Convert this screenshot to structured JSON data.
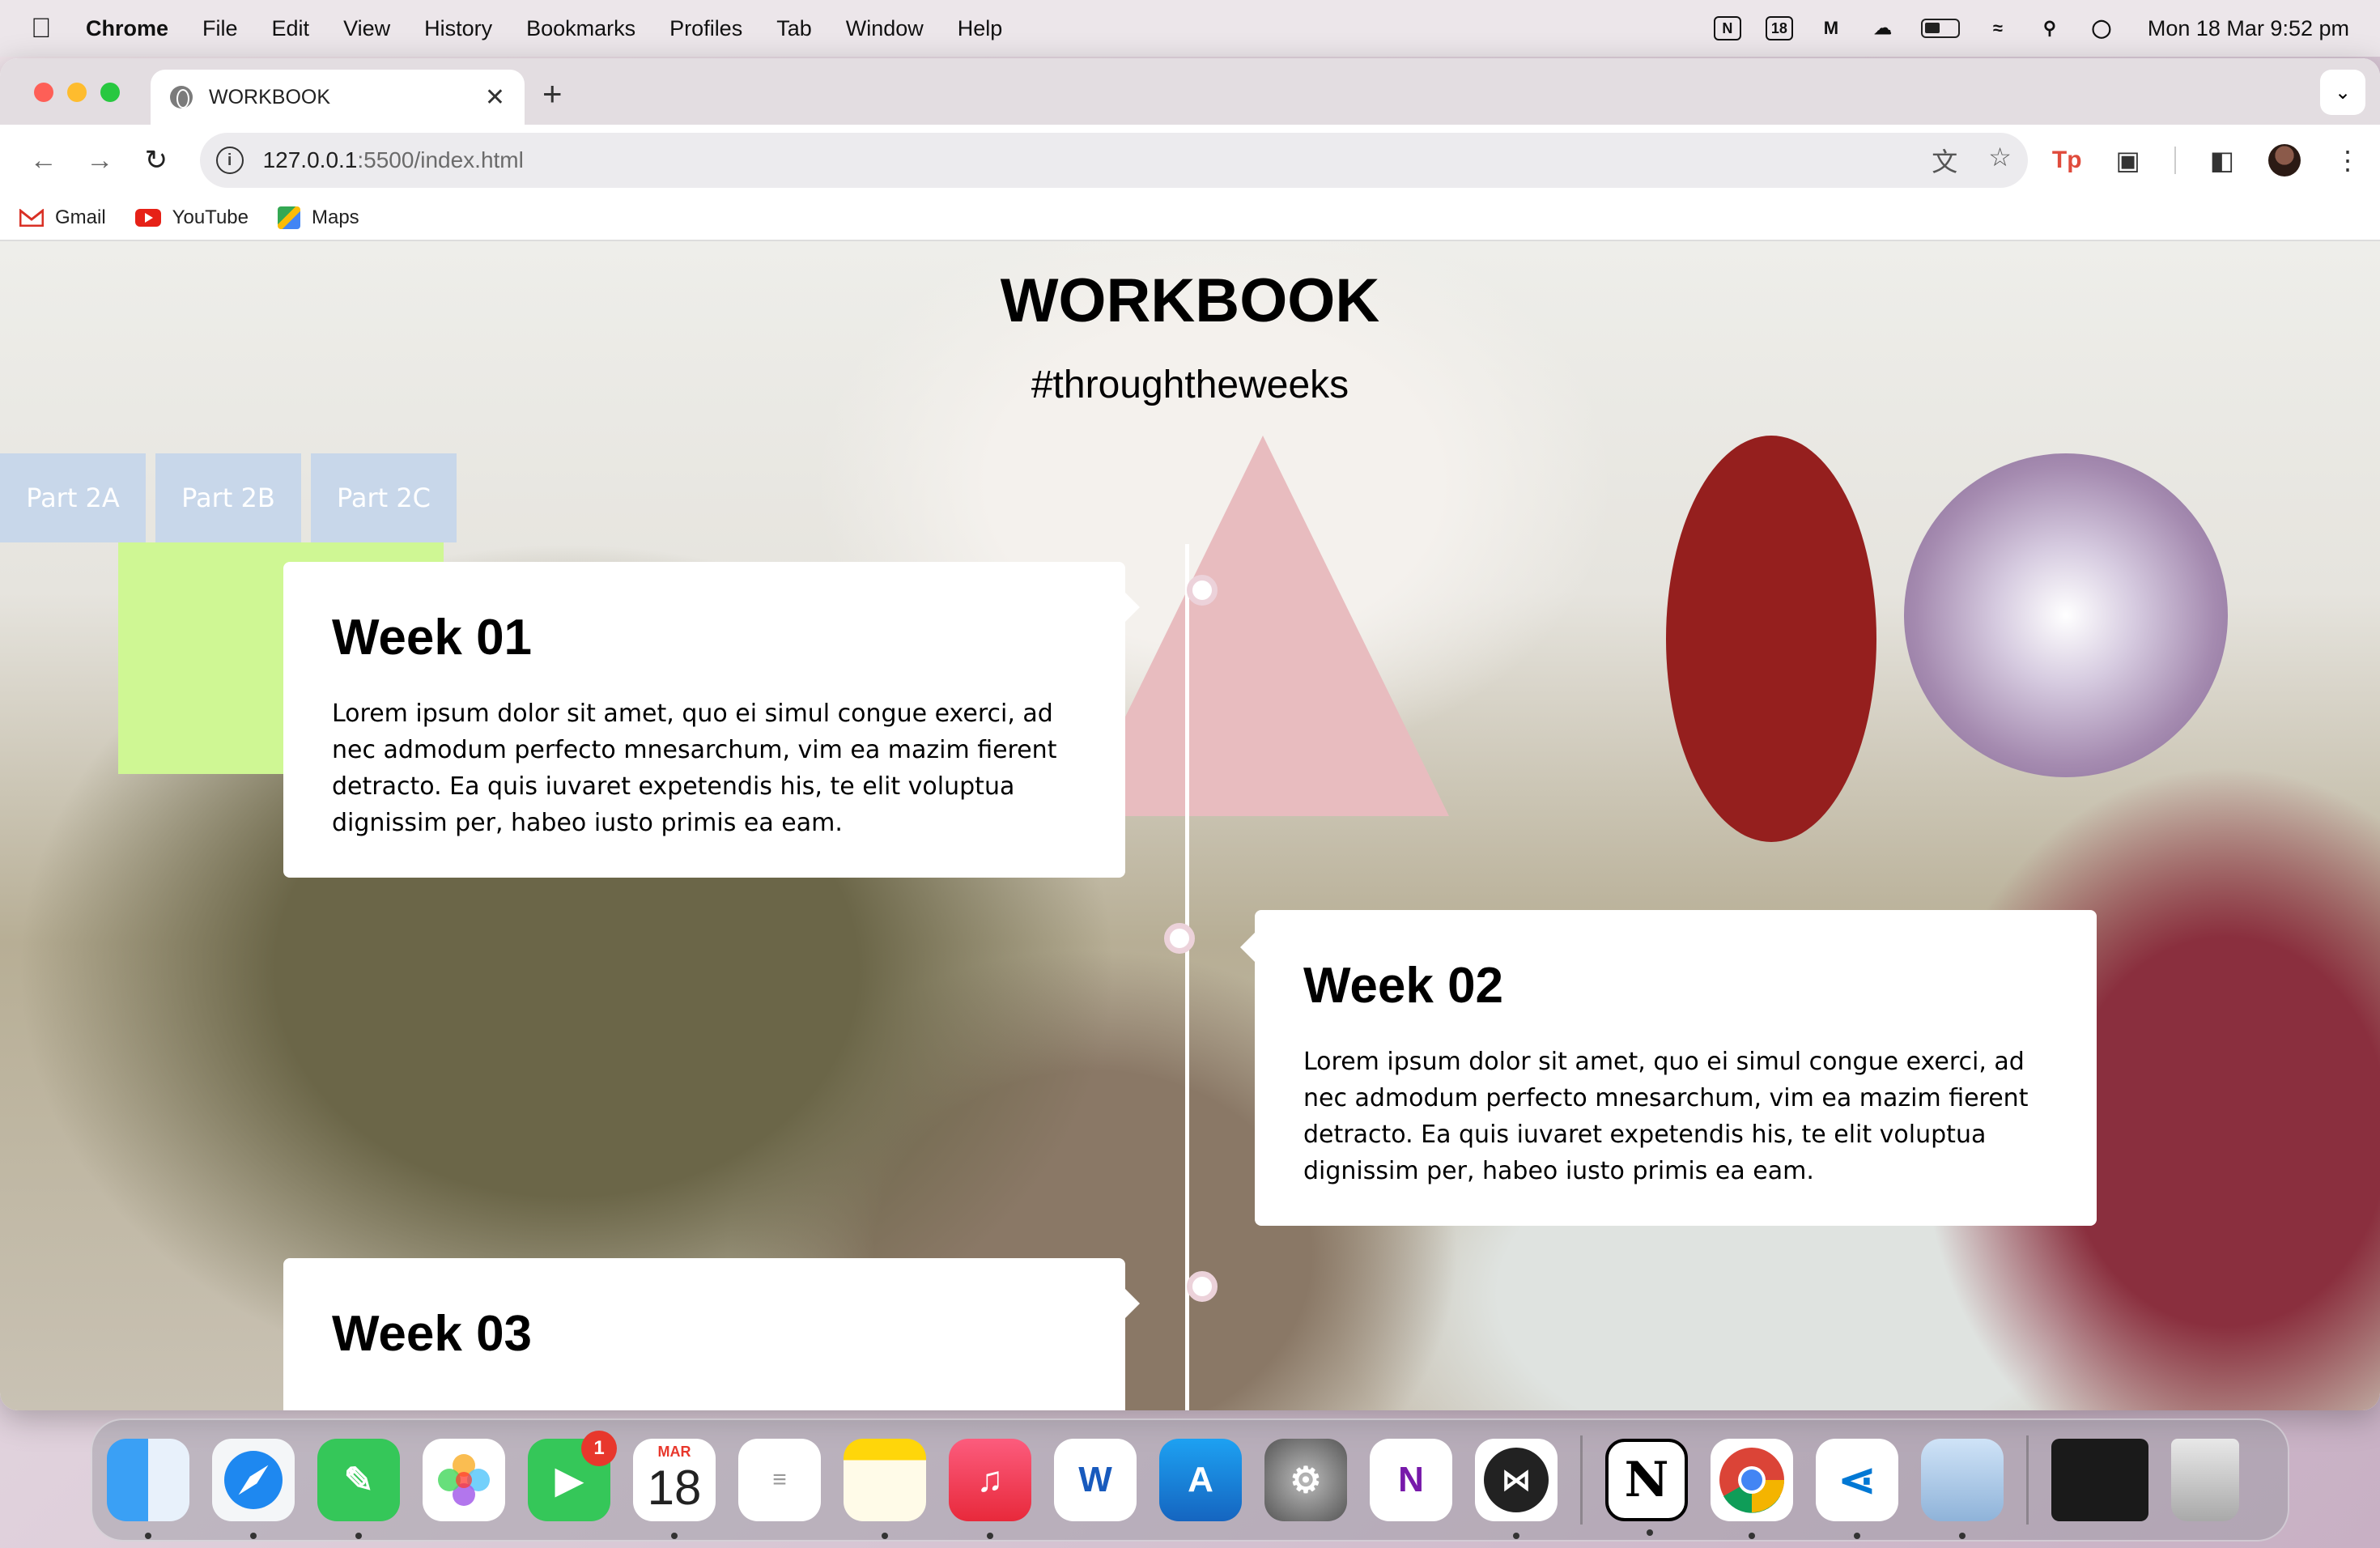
{
  "menubar": {
    "app_name": "Chrome",
    "items": [
      "File",
      "Edit",
      "View",
      "History",
      "Bookmarks",
      "Profiles",
      "Tab",
      "Window",
      "Help"
    ],
    "calendar_icon_text": "18",
    "clock": "Mon 18 Mar  9:52 pm"
  },
  "browser": {
    "tab_title": "WORKBOOK",
    "url_host": "127.0.0.1",
    "url_path": ":5500/index.html",
    "bookmarks": [
      "Gmail",
      "YouTube",
      "Maps"
    ]
  },
  "page": {
    "title": "WORKBOOK",
    "subtitle": "#throughtheweeks",
    "parts": [
      "Part 2A",
      "Part 2B",
      "Part 2C"
    ],
    "weeks": [
      {
        "title": "Week 01",
        "text": "Lorem ipsum dolor sit amet, quo ei simul congue exerci, ad nec admodum perfecto mnesarchum, vim ea mazim fierent detracto. Ea quis iuvaret expetendis his, te elit voluptua dignissim per, habeo iusto primis ea eam."
      },
      {
        "title": "Week 02",
        "text": "Lorem ipsum dolor sit amet, quo ei simul congue exerci, ad nec admodum perfecto mnesarchum, vim ea mazim fierent detracto. Ea quis iuvaret expetendis his, te elit voluptua dignissim per, habeo iusto primis ea eam."
      },
      {
        "title": "Week 03",
        "text": ""
      }
    ],
    "colors": {
      "part_tab": "#c8d7ea",
      "green_block": "#cff794",
      "triangle": "#e8bcbf",
      "ellipse": "#951f1e",
      "sphere": "#a58bb0"
    }
  },
  "dock": {
    "apps": [
      "Finder",
      "Safari",
      "Messages",
      "Photos",
      "FaceTime",
      "Calendar",
      "Reminders",
      "Notes",
      "Music",
      "Word",
      "App Store",
      "System Settings",
      "OneNote",
      "Linear",
      "Notion",
      "Chrome",
      "VS Code",
      "Preview",
      "Downloads",
      "Trash"
    ],
    "facetime_badge": "1",
    "calendar_month": "MAR",
    "calendar_day": "18"
  }
}
